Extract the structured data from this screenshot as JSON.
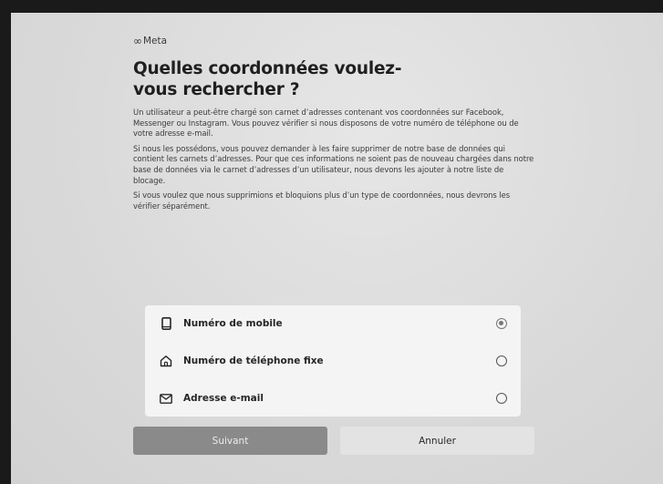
{
  "brand": {
    "logo_text": "Meta",
    "logo_symbol": "∞"
  },
  "page": {
    "title": "Quelles coordonnées voulez-vous rechercher ?",
    "paragraphs": [
      "Un utilisateur a peut-être chargé son carnet d’adresses contenant vos coordonnées sur Facebook, Messenger ou Instagram. Vous pouvez vérifier si nous disposons de votre numéro de téléphone ou de votre adresse e-mail.",
      "Si nous les possédons, vous pouvez demander à les faire supprimer de notre base de données qui contient les carnets d’adresses. Pour que ces informations ne soient pas de nouveau chargées dans notre base de données via le carnet d’adresses d’un utilisateur, nous devons les ajouter à notre liste de blocage.",
      "Si vous voulez que nous supprimions et bloquions plus d’un type de coordonnées, nous devrons les vérifier séparément."
    ]
  },
  "options": [
    {
      "label": "Numéro de mobile",
      "icon": "mobile-phone-icon",
      "selected": true
    },
    {
      "label": "Numéro de téléphone fixe",
      "icon": "home-icon",
      "selected": false
    },
    {
      "label": "Adresse e-mail",
      "icon": "envelope-icon",
      "selected": false
    }
  ],
  "buttons": {
    "next": "Suivant",
    "cancel": "Annuler"
  },
  "colors": {
    "primary_button": "#8a8a8a",
    "secondary_button": "#e3e3e3",
    "options_card": "#f4f4f4"
  }
}
